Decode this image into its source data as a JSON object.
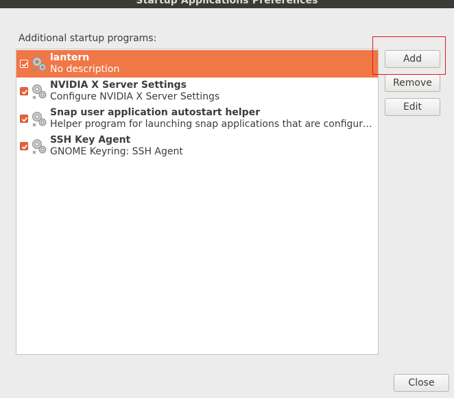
{
  "window": {
    "title": "Startup Applications Preferences"
  },
  "main": {
    "section_label": "Additional startup programs:"
  },
  "programs": [
    {
      "name": "lantern",
      "description": "No description",
      "enabled": true,
      "selected": true,
      "icon": "gears-icon"
    },
    {
      "name": "NVIDIA X Server Settings",
      "description": "Configure NVIDIA X Server Settings",
      "enabled": true,
      "selected": false,
      "icon": "gears-icon"
    },
    {
      "name": "Snap user application autostart helper",
      "description": "Helper program for launching snap applications that are configured t…",
      "enabled": true,
      "selected": false,
      "icon": "gears-icon"
    },
    {
      "name": "SSH Key Agent",
      "description": "GNOME Keyring: SSH Agent",
      "enabled": true,
      "selected": false,
      "icon": "gears-icon"
    }
  ],
  "buttons": {
    "add": "Add",
    "remove": "Remove",
    "edit": "Edit",
    "close": "Close"
  },
  "colors": {
    "selection": "#f07746",
    "checkbox": "#e8623a",
    "annotation": "#e01818",
    "titlebar": "#3b3a36"
  }
}
